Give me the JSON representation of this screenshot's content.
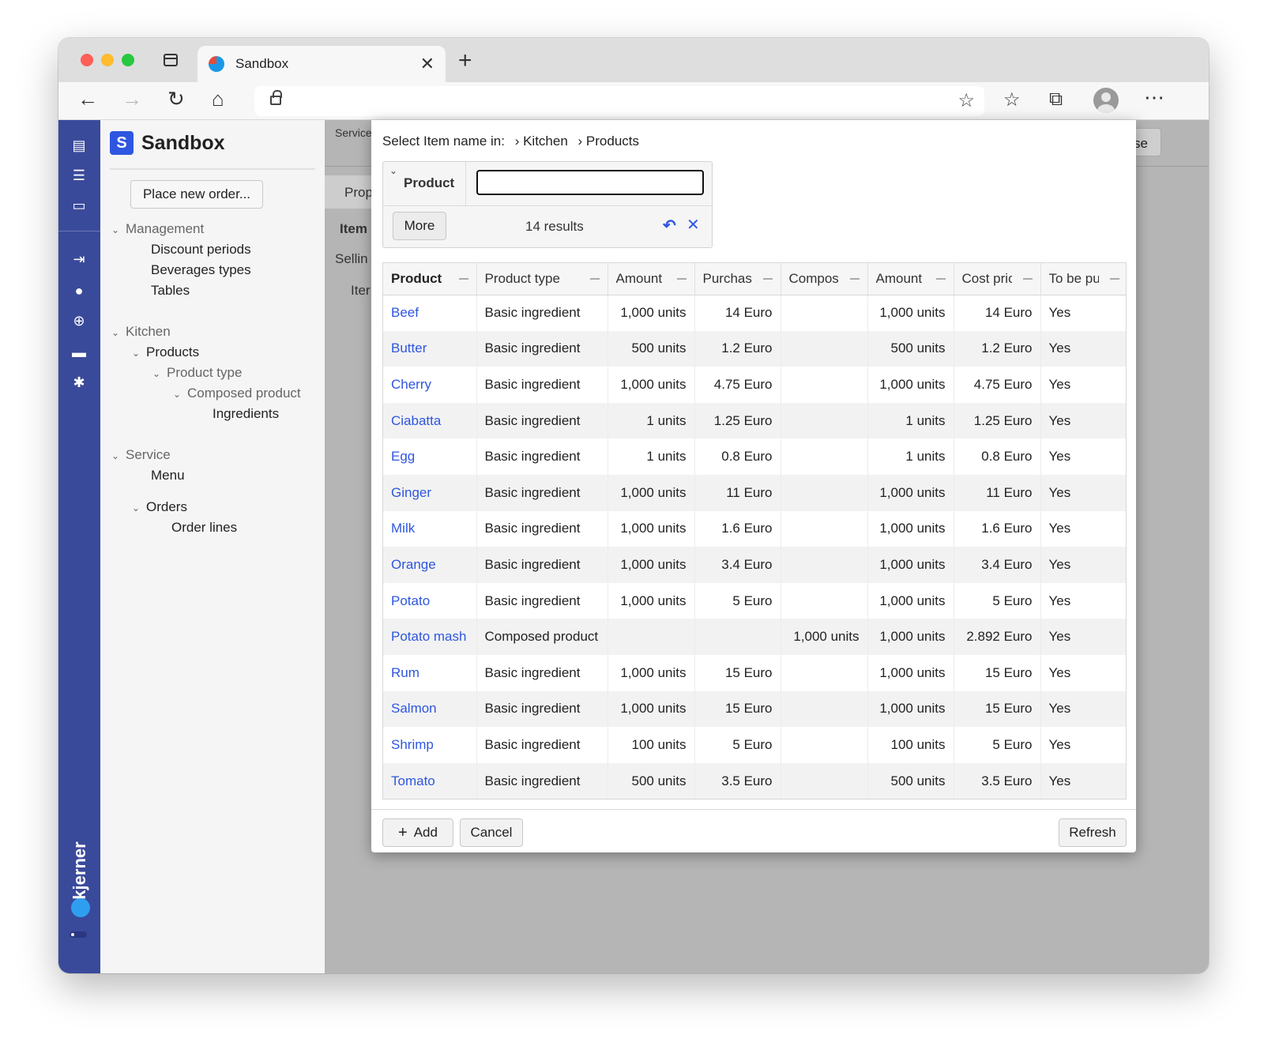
{
  "browser": {
    "tab_title": "Sandbox",
    "tab_close": "✕",
    "new_tab": "+"
  },
  "sidebar": {
    "app_logo": "S",
    "app_name": "Sandbox",
    "place_order": "Place new order...",
    "nav": [
      {
        "label": "Management",
        "group": true
      },
      {
        "label": "Discount periods"
      },
      {
        "label": "Beverages types"
      },
      {
        "label": "Tables"
      },
      {
        "label": "Kitchen",
        "group": true
      },
      {
        "label": "Products"
      },
      {
        "label": "Product type",
        "group": true
      },
      {
        "label": "Composed product",
        "group": true
      },
      {
        "label": "Ingredients"
      },
      {
        "label": "Service",
        "group": true
      },
      {
        "label": "Menu"
      },
      {
        "label": "Orders"
      },
      {
        "label": "Order lines"
      }
    ],
    "brand_mark": "kjerner"
  },
  "background": {
    "service_label": "Service",
    "tab_label": "Prop",
    "item_label": "Item",
    "selling_label": "Sellin",
    "iter_label": "Iter",
    "close_label": "se"
  },
  "dialog": {
    "breadcrumb": {
      "prefix": "Select Item name in:",
      "crumbs": [
        "› Kitchen",
        "› Products"
      ]
    },
    "filter": {
      "label": "Product",
      "input_value": "",
      "more_label": "More",
      "results_text": "14 results"
    },
    "table": {
      "columns": [
        "Product",
        "Product type",
        "Amount",
        "Purchas",
        "Compos",
        "Amount",
        "Cost pric",
        "To be pu"
      ],
      "rows": [
        [
          "Beef",
          "Basic ingredient",
          "1,000 units",
          "14 Euro",
          "",
          "1,000 units",
          "14 Euro",
          "Yes"
        ],
        [
          "Butter",
          "Basic ingredient",
          "500 units",
          "1.2 Euro",
          "",
          "500 units",
          "1.2 Euro",
          "Yes"
        ],
        [
          "Cherry",
          "Basic ingredient",
          "1,000 units",
          "4.75 Euro",
          "",
          "1,000 units",
          "4.75 Euro",
          "Yes"
        ],
        [
          "Ciabatta",
          "Basic ingredient",
          "1 units",
          "1.25 Euro",
          "",
          "1 units",
          "1.25 Euro",
          "Yes"
        ],
        [
          "Egg",
          "Basic ingredient",
          "1 units",
          "0.8 Euro",
          "",
          "1 units",
          "0.8 Euro",
          "Yes"
        ],
        [
          "Ginger",
          "Basic ingredient",
          "1,000 units",
          "11 Euro",
          "",
          "1,000 units",
          "11 Euro",
          "Yes"
        ],
        [
          "Milk",
          "Basic ingredient",
          "1,000 units",
          "1.6 Euro",
          "",
          "1,000 units",
          "1.6 Euro",
          "Yes"
        ],
        [
          "Orange",
          "Basic ingredient",
          "1,000 units",
          "3.4 Euro",
          "",
          "1,000 units",
          "3.4 Euro",
          "Yes"
        ],
        [
          "Potato",
          "Basic ingredient",
          "1,000 units",
          "5 Euro",
          "",
          "1,000 units",
          "5 Euro",
          "Yes"
        ],
        [
          "Potato mash",
          "Composed product",
          "",
          "",
          "1,000 units",
          "1,000 units",
          "2.892 Euro",
          "Yes"
        ],
        [
          "Rum",
          "Basic ingredient",
          "1,000 units",
          "15 Euro",
          "",
          "1,000 units",
          "15 Euro",
          "Yes"
        ],
        [
          "Salmon",
          "Basic ingredient",
          "1,000 units",
          "15 Euro",
          "",
          "1,000 units",
          "15 Euro",
          "Yes"
        ],
        [
          "Shrimp",
          "Basic ingredient",
          "100 units",
          "5 Euro",
          "",
          "100 units",
          "5 Euro",
          "Yes"
        ],
        [
          "Tomato",
          "Basic ingredient",
          "500 units",
          "3.5 Euro",
          "",
          "500 units",
          "3.5 Euro",
          "Yes"
        ]
      ]
    },
    "footer": {
      "add_label": "Add",
      "cancel_label": "Cancel",
      "refresh_label": "Refresh"
    }
  },
  "colors": {
    "rail": "#3a4a9b",
    "link": "#2e56e0",
    "brand_logo": "#2e56e0"
  },
  "icons": {
    "rail": [
      "document-icon",
      "list-check-icon",
      "window-icon",
      "login-icon",
      "palette-icon",
      "globe-icon",
      "keyboard-icon",
      "gear-icon"
    ]
  }
}
